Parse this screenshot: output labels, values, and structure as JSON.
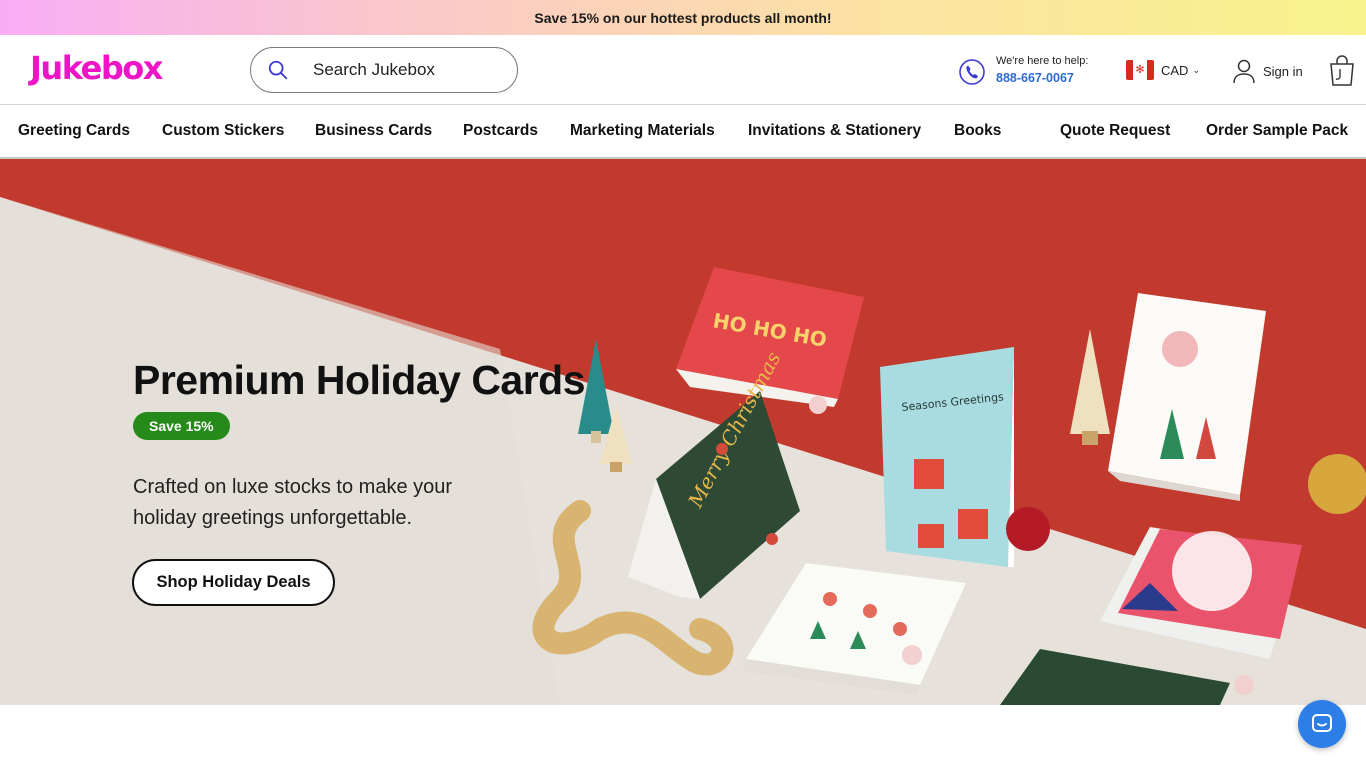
{
  "promo": {
    "text": "Save 15% on our hottest products all month!"
  },
  "header": {
    "logo": "Jukebox",
    "search": {
      "placeholder": "Search Jukebox",
      "value": ""
    },
    "help": {
      "label": "We're here to help:",
      "phone": "888-667-0067"
    },
    "currency": {
      "label": "CAD",
      "flag": "canada-flag"
    },
    "signin": {
      "label": "Sign in"
    }
  },
  "nav": {
    "items": [
      {
        "label": "Greeting Cards"
      },
      {
        "label": "Custom Stickers"
      },
      {
        "label": "Business Cards"
      },
      {
        "label": "Postcards"
      },
      {
        "label": "Marketing Materials"
      },
      {
        "label": "Invitations & Stationery"
      },
      {
        "label": "Books"
      },
      {
        "label": "Quote Request"
      },
      {
        "label": "Order Sample Pack"
      }
    ]
  },
  "hero": {
    "title": "Premium Holiday Cards",
    "badge": "Save 15%",
    "subtitle": "Crafted on luxe stocks to make your holiday greetings unforgettable.",
    "cta": "Shop Holiday Deals",
    "cards": {
      "hohoho": "HO HO HO",
      "merry_christmas": "Merry Christmas",
      "seasons": "Seasons Greetings"
    }
  },
  "colors": {
    "brand": "#ee15c7",
    "link": "#2d6ad8",
    "badge": "#258a19",
    "hero_red": "#c23a2e",
    "chat": "#2d7ee6"
  }
}
